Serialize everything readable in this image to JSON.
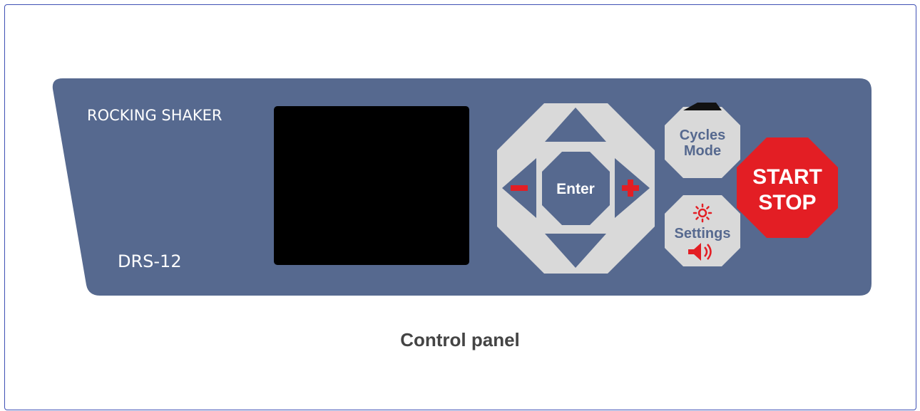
{
  "panel": {
    "brand": "ROCKING SHAKER",
    "model": "DRS-12",
    "panel_color": "#56698f",
    "display_color": "#000000"
  },
  "buttons": {
    "enter": "Enter",
    "minus_symbol": "−",
    "plus_symbol": "+",
    "cycles_line1": "Cycles",
    "cycles_line2": "Mode",
    "settings": "Settings",
    "start": "START",
    "stop": "STOP",
    "button_color": "#d9d9d9",
    "accent_red": "#e31e24"
  },
  "caption": "Control panel"
}
